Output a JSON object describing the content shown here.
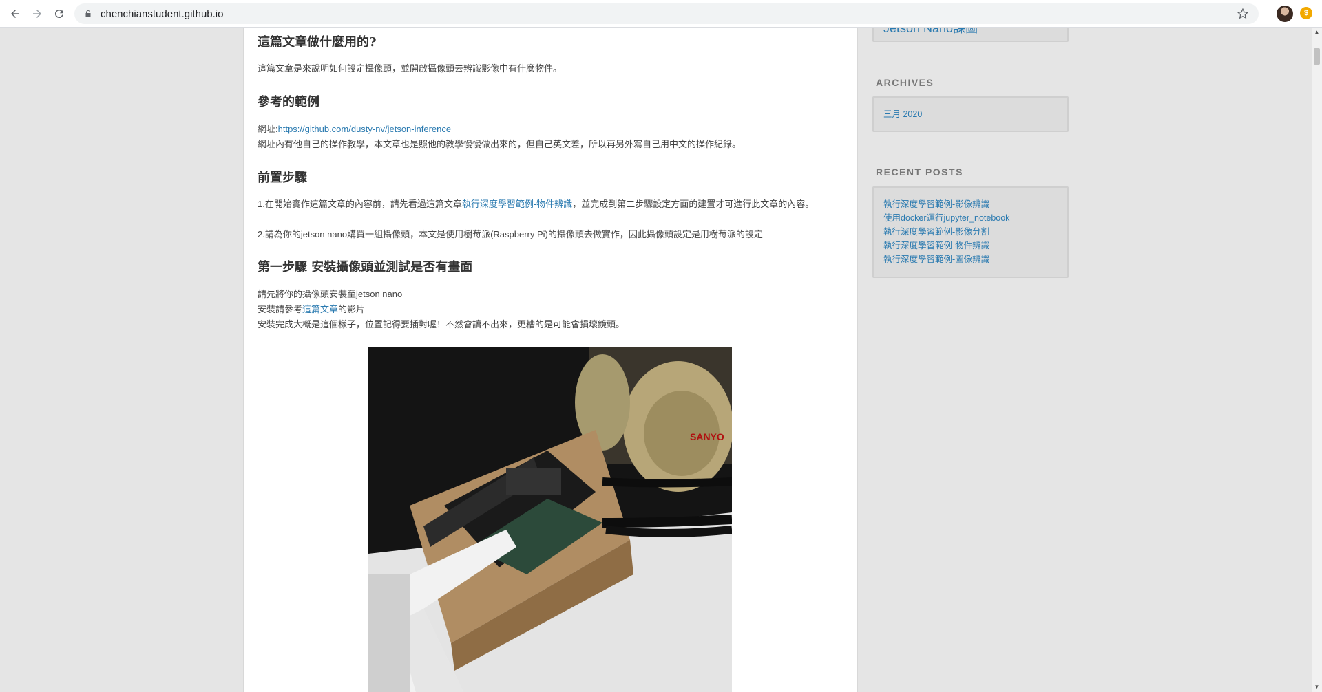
{
  "browser": {
    "url": "chenchianstudent.github.io"
  },
  "article": {
    "heading1": "這篇文章做什麼用的?",
    "para1": "這篇文章是來說明如何設定攝像頭，並開啟攝像頭去辨識影像中有什麼物件。",
    "heading2": "參考的範例",
    "ref_prefix": "網址:",
    "ref_link": "https://github.com/dusty-nv/jetson-inference",
    "ref_note": "網址內有他自己的操作教學，本文章也是照他的教學慢慢做出來的，但自己英文差，所以再另外寫自己用中文的操作紀錄。",
    "heading3": "前置步驟",
    "step1_prefix": "1.在開始實作這篇文章的內容前，請先看過這篇文章",
    "step1_link": "執行深度學習範例-物件辨識",
    "step1_suffix": "，並完成到第二步驟設定方面的建置才可進行此文章的內容。",
    "step2": "2.請為你的jetson nano購買一組攝像頭，本文是使用樹莓派(Raspberry Pi)的攝像頭去做實作，因此攝像頭設定是用樹莓派的設定",
    "heading4": "第一步驟 安裝攝像頭並測試是否有畫面",
    "install1": "請先將你的攝像頭安裝至jetson nano",
    "install2_prefix": "安裝請參考",
    "install2_link": "這篇文章",
    "install2_suffix": "的影片",
    "install3": "安裝完成大概是這個樣子，位置記得要插對喔！不然會讀不出來，更糟的是可能會損壞鏡頭。",
    "photo_brand": "SANYO"
  },
  "sidebar": {
    "top_partial": "Jetson Nano課圖",
    "archives_title": "ARCHIVES",
    "archives_items": [
      "三月 2020"
    ],
    "recent_title": "RECENT POSTS",
    "recent_items": [
      "執行深度學習範例-影像辨識",
      "使用docker運行jupyter_notebook",
      "執行深度學習範例-影像分割",
      "執行深度學習範例-物件辨識",
      "執行深度學習範例-圖像辨識"
    ]
  },
  "icons": {
    "back": "back-arrow-icon",
    "forward": "forward-arrow-icon",
    "reload": "reload-icon",
    "lock": "lock-icon",
    "star": "star-icon"
  }
}
